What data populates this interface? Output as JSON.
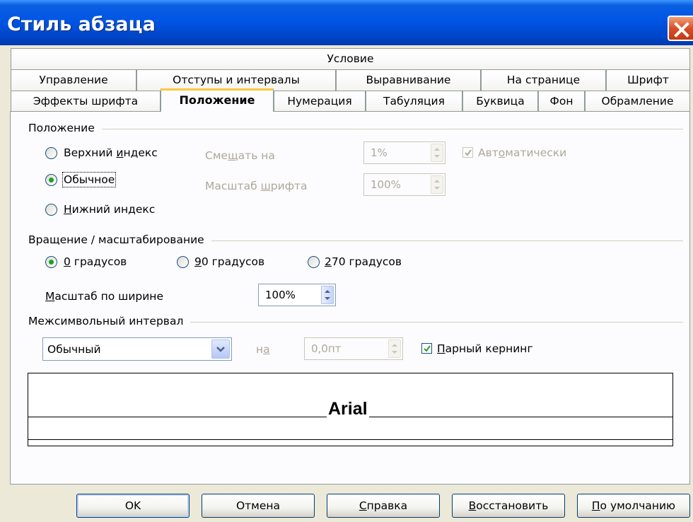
{
  "window": {
    "title": "Стиль абзаца",
    "close_icon": "close-icon"
  },
  "tabs": {
    "row0": [
      "Условие"
    ],
    "row1": [
      "Управление",
      "Отступы и интервалы",
      "Выравнивание",
      "На странице",
      "Шрифт"
    ],
    "row2": [
      "Эффекты шрифта",
      "Положение",
      "Нумерация",
      "Табуляция",
      "Буквица",
      "Фон",
      "Обрамление"
    ],
    "active": "Положение"
  },
  "position": {
    "title": "Положение",
    "superscript": {
      "pre": "Верхний ",
      "u": "и",
      "post": "ндекс",
      "selected": false
    },
    "normal": {
      "label": "Обычное",
      "selected": true
    },
    "subscript": {
      "pre": "",
      "u": "Н",
      "post": "ижний индекс",
      "selected": false
    },
    "raise_by": {
      "pre": "Сме",
      "u": "щ",
      "post": "ать на",
      "value": "1%"
    },
    "font_scale": {
      "pre": "Масштаб ",
      "u": "ш",
      "post": "рифта",
      "value": "100%"
    },
    "automatic": {
      "pre": "Авт",
      "u": "о",
      "post": "матически",
      "checked": true
    }
  },
  "rotation": {
    "title": "Вращение / масштабирование",
    "deg0": {
      "u": "0",
      "post": " градусов",
      "selected": true
    },
    "deg90": {
      "u": "9",
      "post": "0 градусов",
      "selected": false
    },
    "deg270": {
      "u": "2",
      "post": "70 градусов",
      "selected": false
    },
    "width_scale": {
      "u": "М",
      "post": "асштаб по ширине",
      "value": "100%"
    }
  },
  "spacing": {
    "title": "Межсимвольный интервал",
    "mode": "Обычный",
    "by": {
      "pre": "н",
      "u": "а",
      "post": ""
    },
    "by_value": "0,0пт",
    "kerning": {
      "u": "П",
      "post": "арный кернинг",
      "checked": true
    }
  },
  "preview": {
    "text": "Arial"
  },
  "buttons": {
    "ok": "OK",
    "cancel": "Отмена",
    "help": {
      "u": "С",
      "post": "правка"
    },
    "reset": {
      "u": "В",
      "post": "осстановить"
    },
    "default": {
      "u": "П",
      "post": "о умолчанию"
    }
  },
  "colors": {
    "title_bar": "#0055e5",
    "radio_dot": "#21a121",
    "active_tab_accent": "#ffc83c"
  }
}
